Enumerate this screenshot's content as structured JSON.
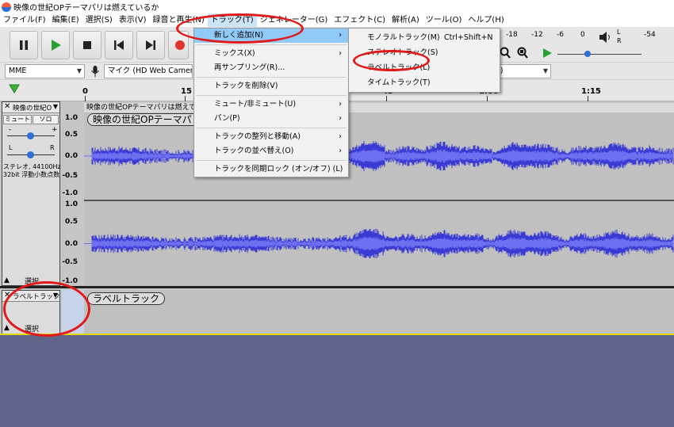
{
  "window": {
    "title": "映像の世紀OPテーマパリは燃えているか"
  },
  "menubar": {
    "items": [
      "ファイル(F)",
      "編集(E)",
      "選択(S)",
      "表示(V)",
      "録音と再生(N)",
      "トラック(T)",
      "ジェネレーター(G)",
      "エフェクト(C)",
      "解析(A)",
      "ツール(O)",
      "ヘルプ(H)"
    ]
  },
  "meter": {
    "ticks": [
      "-18",
      "-12",
      "-6",
      "0"
    ],
    "ticks2": [
      "-54"
    ],
    "l": "L",
    "r": "R"
  },
  "device": {
    "host": "MME",
    "mic": "マイク (HD Web Camera)",
    "speaker_suffix": "o)"
  },
  "timeline": {
    "ticks": [
      "0",
      "15",
      "45",
      "1:00",
      "1:15"
    ]
  },
  "track_menu": {
    "items": [
      "新しく追加(N)",
      "ミックス(X)",
      "再サンプリング(R)...",
      "トラックを削除(V)",
      "ミュート/非ミュート(U)",
      "パン(P)",
      "トラックの整列と移動(A)",
      "トラックの並べ替え(O)",
      "トラックを同期ロック (オン/オフ) (L)"
    ]
  },
  "add_submenu": {
    "items": [
      "モノラルトラック(M)",
      "ステレオトラック(S)",
      "ラベルトラック(L)",
      "タイムトラック(T)"
    ],
    "shortcut": "Ctrl+Shift+N"
  },
  "audio_track": {
    "name": "映像の世紀O",
    "clip_name": "映像の世紀OPテーマパリは燃えているか",
    "clip_label": "映像の世紀OPテーマパリは",
    "mute": "ミュート",
    "solo": "ソロ",
    "gain_minus": "-",
    "gain_plus": "+",
    "pan_l": "L",
    "pan_r": "R",
    "info_line1": "ステレオ, 44100Hz",
    "info_line2": "32bit 浮動小数点数",
    "select": "選択",
    "scale": [
      "1.0",
      "0.5",
      "0.0",
      "-0.5",
      "-1.0"
    ],
    "colors": {
      "wave": "#3a3ad4",
      "wave_rms": "#6f6ff2",
      "background": "#c0c0c0"
    }
  },
  "label_track": {
    "name": "ラベルトラック",
    "select": "選択",
    "label_text": "ラベルトラック"
  },
  "colors": {
    "accent": "#91c9f7",
    "highlight_oval": "#e01919",
    "empty_area": "#5f6689"
  }
}
